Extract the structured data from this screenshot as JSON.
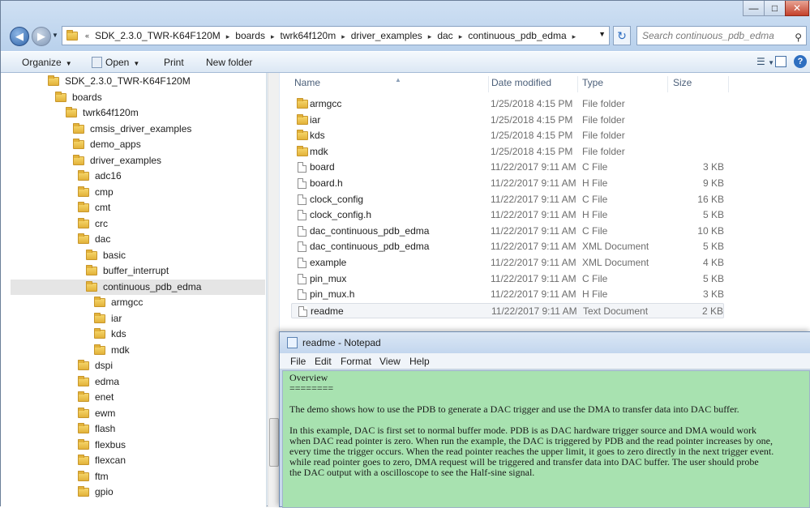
{
  "window": {
    "controls": {
      "minimize": "—",
      "maximize": "□",
      "close": "✕"
    }
  },
  "address_bar": {
    "overflow": "«",
    "crumbs": [
      "SDK_2.3.0_TWR-K64F120M",
      "boards",
      "twrk64f120m",
      "driver_examples",
      "dac",
      "continuous_pdb_edma"
    ],
    "separator": "▸",
    "search_placeholder": "Search continuous_pdb_edma"
  },
  "toolbar": {
    "organize": "Organize",
    "open": "Open",
    "print": "Print",
    "new_folder": "New folder"
  },
  "nav_tree": [
    {
      "label": "SDK_2.3.0_TWR-K64F120M"
    },
    {
      "label": "boards"
    },
    {
      "label": "twrk64f120m"
    },
    {
      "label": "cmsis_driver_examples"
    },
    {
      "label": "demo_apps"
    },
    {
      "label": "driver_examples"
    },
    {
      "label": "adc16"
    },
    {
      "label": "cmp"
    },
    {
      "label": "cmt"
    },
    {
      "label": "crc"
    },
    {
      "label": "dac"
    },
    {
      "label": "basic"
    },
    {
      "label": "buffer_interrupt"
    },
    {
      "label": "continuous_pdb_edma",
      "selected": true
    },
    {
      "label": "armgcc"
    },
    {
      "label": "iar"
    },
    {
      "label": "kds"
    },
    {
      "label": "mdk"
    },
    {
      "label": "dspi"
    },
    {
      "label": "edma"
    },
    {
      "label": "enet"
    },
    {
      "label": "ewm"
    },
    {
      "label": "flash"
    },
    {
      "label": "flexbus"
    },
    {
      "label": "flexcan"
    },
    {
      "label": "ftm"
    },
    {
      "label": "gpio"
    }
  ],
  "columns": {
    "name": "Name",
    "date": "Date modified",
    "type": "Type",
    "size": "Size"
  },
  "files": [
    {
      "name": "armgcc",
      "date": "1/25/2018 4:15 PM",
      "type": "File folder",
      "size": "",
      "folder": true
    },
    {
      "name": "iar",
      "date": "1/25/2018 4:15 PM",
      "type": "File folder",
      "size": "",
      "folder": true
    },
    {
      "name": "kds",
      "date": "1/25/2018 4:15 PM",
      "type": "File folder",
      "size": "",
      "folder": true
    },
    {
      "name": "mdk",
      "date": "1/25/2018 4:15 PM",
      "type": "File folder",
      "size": "",
      "folder": true
    },
    {
      "name": "board",
      "date": "11/22/2017 9:11 AM",
      "type": "C File",
      "size": "3 KB"
    },
    {
      "name": "board.h",
      "date": "11/22/2017 9:11 AM",
      "type": "H File",
      "size": "9 KB"
    },
    {
      "name": "clock_config",
      "date": "11/22/2017 9:11 AM",
      "type": "C File",
      "size": "16 KB"
    },
    {
      "name": "clock_config.h",
      "date": "11/22/2017 9:11 AM",
      "type": "H File",
      "size": "5 KB"
    },
    {
      "name": "dac_continuous_pdb_edma",
      "date": "11/22/2017 9:11 AM",
      "type": "C File",
      "size": "10 KB"
    },
    {
      "name": "dac_continuous_pdb_edma",
      "date": "11/22/2017 9:11 AM",
      "type": "XML Document",
      "size": "5 KB"
    },
    {
      "name": "example",
      "date": "11/22/2017 9:11 AM",
      "type": "XML Document",
      "size": "4 KB"
    },
    {
      "name": "pin_mux",
      "date": "11/22/2017 9:11 AM",
      "type": "C File",
      "size": "5 KB"
    },
    {
      "name": "pin_mux.h",
      "date": "11/22/2017 9:11 AM",
      "type": "H File",
      "size": "3 KB"
    },
    {
      "name": "readme",
      "date": "11/22/2017 9:11 AM",
      "type": "Text Document",
      "size": "2 KB",
      "highlighted": true
    }
  ],
  "notepad": {
    "title": "readme - Notepad",
    "menu": [
      "File",
      "Edit",
      "Format",
      "View",
      "Help"
    ],
    "lines": [
      "Overview",
      "========",
      "",
      "The demo shows how to use the PDB to generate a DAC trigger and use the DMA to transfer data into DAC buffer.",
      "",
      "In this example, DAC is first set to normal buffer mode. PDB is as DAC hardware trigger source and DMA would work",
      "when DAC read pointer is zero. When run the example, the DAC is triggered by PDB and the read pointer increases by one,",
      "every time the trigger occurs. When the read pointer reaches the upper limit, it goes to zero directly in the next trigger event.",
      "while read pointer goes to zero, DMA request will be triggered and transfer data into DAC buffer. The user should probe",
      "the DAC output with a oscilloscope to see the Half-sine signal."
    ]
  }
}
